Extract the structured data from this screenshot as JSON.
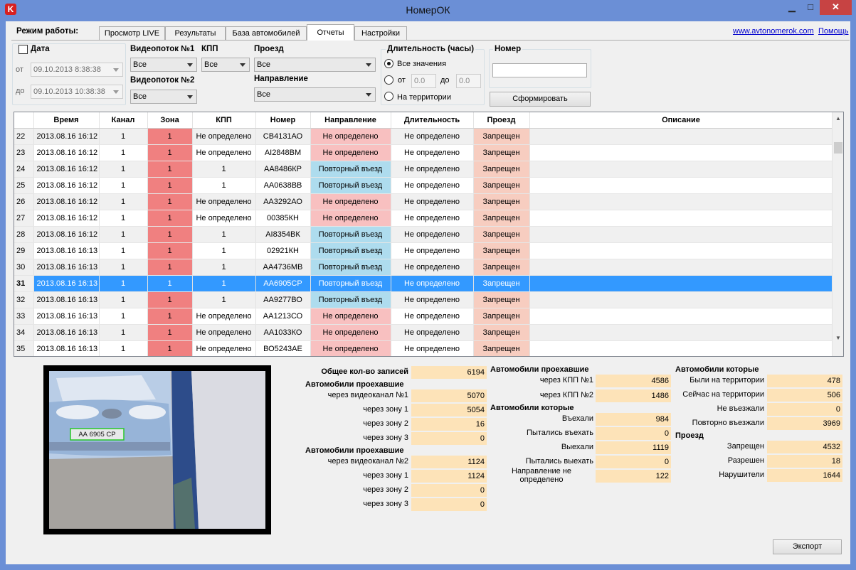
{
  "window": {
    "title": "НомерОК",
    "icon_letter": "K",
    "minimize": "▁",
    "maximize": "□",
    "close": "✕"
  },
  "mode": {
    "label": "Режим работы:",
    "tabs": [
      "Просмотр LIVE",
      "Результаты",
      "База автомобилей",
      "Отчеты",
      "Настройки"
    ],
    "active_tab": "Отчеты"
  },
  "links": {
    "site": "www.avtonomerok.com",
    "help": "Помощь"
  },
  "filters": {
    "date_label": "Дата",
    "from_label": "от",
    "to_label": "до",
    "date_from": "09.10.2013  8:38:38",
    "date_to": "09.10.2013 10:38:38",
    "video1_label": "Видеопоток №1",
    "video1_value": "Все",
    "kpp_label": "КПП",
    "kpp_value": "Все",
    "video2_label": "Видеопоток №2",
    "video2_value": "Все",
    "pass_label": "Проезд",
    "pass_value": "Все",
    "direction_label": "Направление",
    "direction_value": "Все",
    "duration_label": "Длительность (часы)",
    "dur_all": "Все значения",
    "dur_from": "от",
    "dur_to": "до",
    "dur_from_value": "0.0",
    "dur_to_value": "0.0",
    "dur_territory": "На территории",
    "number_label": "Номер",
    "number_value": "",
    "generate_button": "Сформировать"
  },
  "table": {
    "columns": [
      "",
      "Время",
      "Канал",
      "Зона",
      "КПП",
      "Номер",
      "Направление",
      "Длительность",
      "Проезд",
      "Описание"
    ],
    "rows": [
      {
        "n": "22",
        "time": "2013.08.16 16:12",
        "ch": "1",
        "zone": "1",
        "kpp": "Не определено",
        "num": "СВ4131АО",
        "dir": "Не определено",
        "dur": "Не определено",
        "pass": "Запрещен",
        "desc": ""
      },
      {
        "n": "23",
        "time": "2013.08.16 16:12",
        "ch": "1",
        "zone": "1",
        "kpp": "Не определено",
        "num": "АІ2848ВМ",
        "dir": "Не определено",
        "dur": "Не определено",
        "pass": "Запрещен",
        "desc": ""
      },
      {
        "n": "24",
        "time": "2013.08.16 16:12",
        "ch": "1",
        "zone": "1",
        "kpp": "1",
        "num": "АА8486КР",
        "dir": "Повторный въезд",
        "dur": "Не определено",
        "pass": "Запрещен",
        "desc": ""
      },
      {
        "n": "25",
        "time": "2013.08.16 16:12",
        "ch": "1",
        "zone": "1",
        "kpp": "1",
        "num": "АА0638ВВ",
        "dir": "Повторный въезд",
        "dur": "Не определено",
        "pass": "Запрещен",
        "desc": ""
      },
      {
        "n": "26",
        "time": "2013.08.16 16:12",
        "ch": "1",
        "zone": "1",
        "kpp": "Не определено",
        "num": "АА3292АО",
        "dir": "Не определено",
        "dur": "Не определено",
        "pass": "Запрещен",
        "desc": ""
      },
      {
        "n": "27",
        "time": "2013.08.16 16:12",
        "ch": "1",
        "zone": "1",
        "kpp": "Не определено",
        "num": "00385КН",
        "dir": "Не определено",
        "dur": "Не определено",
        "pass": "Запрещен",
        "desc": ""
      },
      {
        "n": "28",
        "time": "2013.08.16 16:12",
        "ch": "1",
        "zone": "1",
        "kpp": "1",
        "num": "АІ8354ВК",
        "dir": "Повторный въезд",
        "dur": "Не определено",
        "pass": "Запрещен",
        "desc": ""
      },
      {
        "n": "29",
        "time": "2013.08.16 16:13",
        "ch": "1",
        "zone": "1",
        "kpp": "1",
        "num": "02921КН",
        "dir": "Повторный въезд",
        "dur": "Не определено",
        "pass": "Запрещен",
        "desc": ""
      },
      {
        "n": "30",
        "time": "2013.08.16 16:13",
        "ch": "1",
        "zone": "1",
        "kpp": "1",
        "num": "АА4736МВ",
        "dir": "Повторный въезд",
        "dur": "Не определено",
        "pass": "Запрещен",
        "desc": ""
      },
      {
        "n": "31",
        "time": "2013.08.16 16:13",
        "ch": "1",
        "zone": "1",
        "kpp": "1",
        "num": "АА6905СР",
        "dir": "Повторный въезд",
        "dur": "Не определено",
        "pass": "Запрещен",
        "desc": ""
      },
      {
        "n": "32",
        "time": "2013.08.16 16:13",
        "ch": "1",
        "zone": "1",
        "kpp": "1",
        "num": "АА9277ВО",
        "dir": "Повторный въезд",
        "dur": "Не определено",
        "pass": "Запрещен",
        "desc": ""
      },
      {
        "n": "33",
        "time": "2013.08.16 16:13",
        "ch": "1",
        "zone": "1",
        "kpp": "Не определено",
        "num": "АА1213СО",
        "dir": "Не определено",
        "dur": "Не определено",
        "pass": "Запрещен",
        "desc": ""
      },
      {
        "n": "34",
        "time": "2013.08.16 16:13",
        "ch": "1",
        "zone": "1",
        "kpp": "Не определено",
        "num": "АА1033КО",
        "dir": "Не определено",
        "dur": "Не определено",
        "pass": "Запрещен",
        "desc": ""
      },
      {
        "n": "35",
        "time": "2013.08.16 16:13",
        "ch": "1",
        "zone": "1",
        "kpp": "Не определено",
        "num": "ВО5243АЕ",
        "dir": "Не определено",
        "dur": "Не определено",
        "pass": "Запрещен",
        "desc": ""
      }
    ],
    "selected_row": "31"
  },
  "video": {
    "plate_text": "АА 6905 СР"
  },
  "stats": {
    "total_label": "Общее кол-во записей",
    "total_value": "6194",
    "ch1_head": "Автомобили проехавшие",
    "ch1_rows": [
      {
        "label": "через видеоканал №1",
        "value": "5070"
      },
      {
        "label": "через зону 1",
        "value": "5054"
      },
      {
        "label": "через зону 2",
        "value": "16"
      },
      {
        "label": "через зону 3",
        "value": "0"
      }
    ],
    "ch2_head": "Автомобили проехавшие",
    "ch2_rows": [
      {
        "label": "через видеоканал №2",
        "value": "1124"
      },
      {
        "label": "через зону 1",
        "value": "1124"
      },
      {
        "label": "через зону 2",
        "value": "0"
      },
      {
        "label": "через зону 3",
        "value": "0"
      }
    ],
    "kpp_head": "Автомобили проехавшие",
    "kpp_rows": [
      {
        "label": "через КПП №1",
        "value": "4586"
      },
      {
        "label": "через КПП №2",
        "value": "1486"
      }
    ],
    "which_head": "Автомобили которые",
    "which_rows": [
      {
        "label": "Въехали",
        "value": "984"
      },
      {
        "label": "Пытались въехать",
        "value": "0"
      },
      {
        "label": "Выехали",
        "value": "1119"
      },
      {
        "label": "Пытались выехать",
        "value": "0"
      },
      {
        "label": "Направление не определено",
        "value": "122"
      }
    ],
    "terr_head": "Автомобили которые",
    "terr_rows": [
      {
        "label": "Были на территории",
        "value": "478"
      },
      {
        "label": "Сейчас на территории",
        "value": "506"
      },
      {
        "label": "Не въезжали",
        "value": "0"
      },
      {
        "label": "Повторно въезжали",
        "value": "3969"
      }
    ],
    "pass_head": "Проезд",
    "pass_rows": [
      {
        "label": "Запрещен",
        "value": "4532"
      },
      {
        "label": "Разрешен",
        "value": "18"
      },
      {
        "label": "Нарушители",
        "value": "1644"
      }
    ]
  },
  "export_button": "Экспорт",
  "colors": {
    "titlebar": "#6b8fd6",
    "zone_red": "#f08080",
    "dir_undefined": "#f8c0c0",
    "dir_repeat": "#aedcee",
    "pass_denied": "#f7cdc0",
    "selection": "#3399ff",
    "stat_value_bg": "#fde3b8"
  }
}
